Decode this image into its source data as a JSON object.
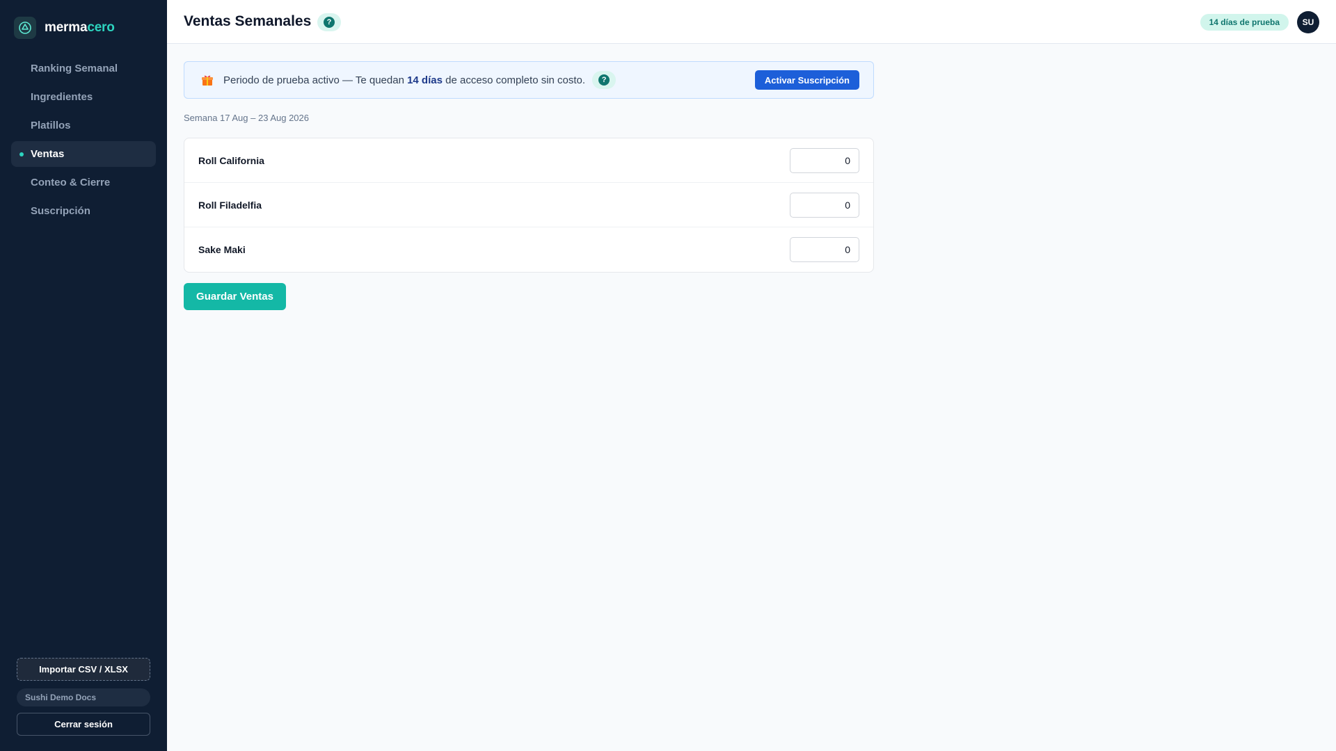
{
  "brand": {
    "name_part1": "merma",
    "name_part2": "cero",
    "logo_icon": "recycle-logo-icon"
  },
  "sidebar": {
    "items": [
      {
        "label": "Ranking Semanal",
        "active": false
      },
      {
        "label": "Ingredientes",
        "active": false
      },
      {
        "label": "Platillos",
        "active": false
      },
      {
        "label": "Ventas",
        "active": true
      },
      {
        "label": "Conteo & Cierre",
        "active": false
      },
      {
        "label": "Suscripción",
        "active": false
      }
    ],
    "import_button": "Importar CSV / XLSX",
    "org_name": "Sushi Demo Docs",
    "logout_button": "Cerrar sesión"
  },
  "header": {
    "title": "Ventas Semanales",
    "help_glyph": "?",
    "trial_badge": "14 días de prueba",
    "avatar_initials": "SU"
  },
  "banner": {
    "icon": "gift-icon",
    "text_before": "Periodo de prueba activo — Te quedan ",
    "text_bold": "14 días",
    "text_after": " de acceso completo sin costo.",
    "help_glyph": "?",
    "button": "Activar Suscripción"
  },
  "week_label": "Semana 17 Aug – 23 Aug 2026",
  "sales": [
    {
      "name": "Roll California",
      "quantity": "0"
    },
    {
      "name": "Roll Filadelfia",
      "quantity": "0"
    },
    {
      "name": "Sake Maki",
      "quantity": "0"
    }
  ],
  "save_button": "Guardar Ventas",
  "colors": {
    "sidebar_bg": "#0f1e33",
    "accent_teal": "#14b8a6",
    "primary_blue": "#1d5fd9",
    "banner_bg": "#eff6ff"
  }
}
